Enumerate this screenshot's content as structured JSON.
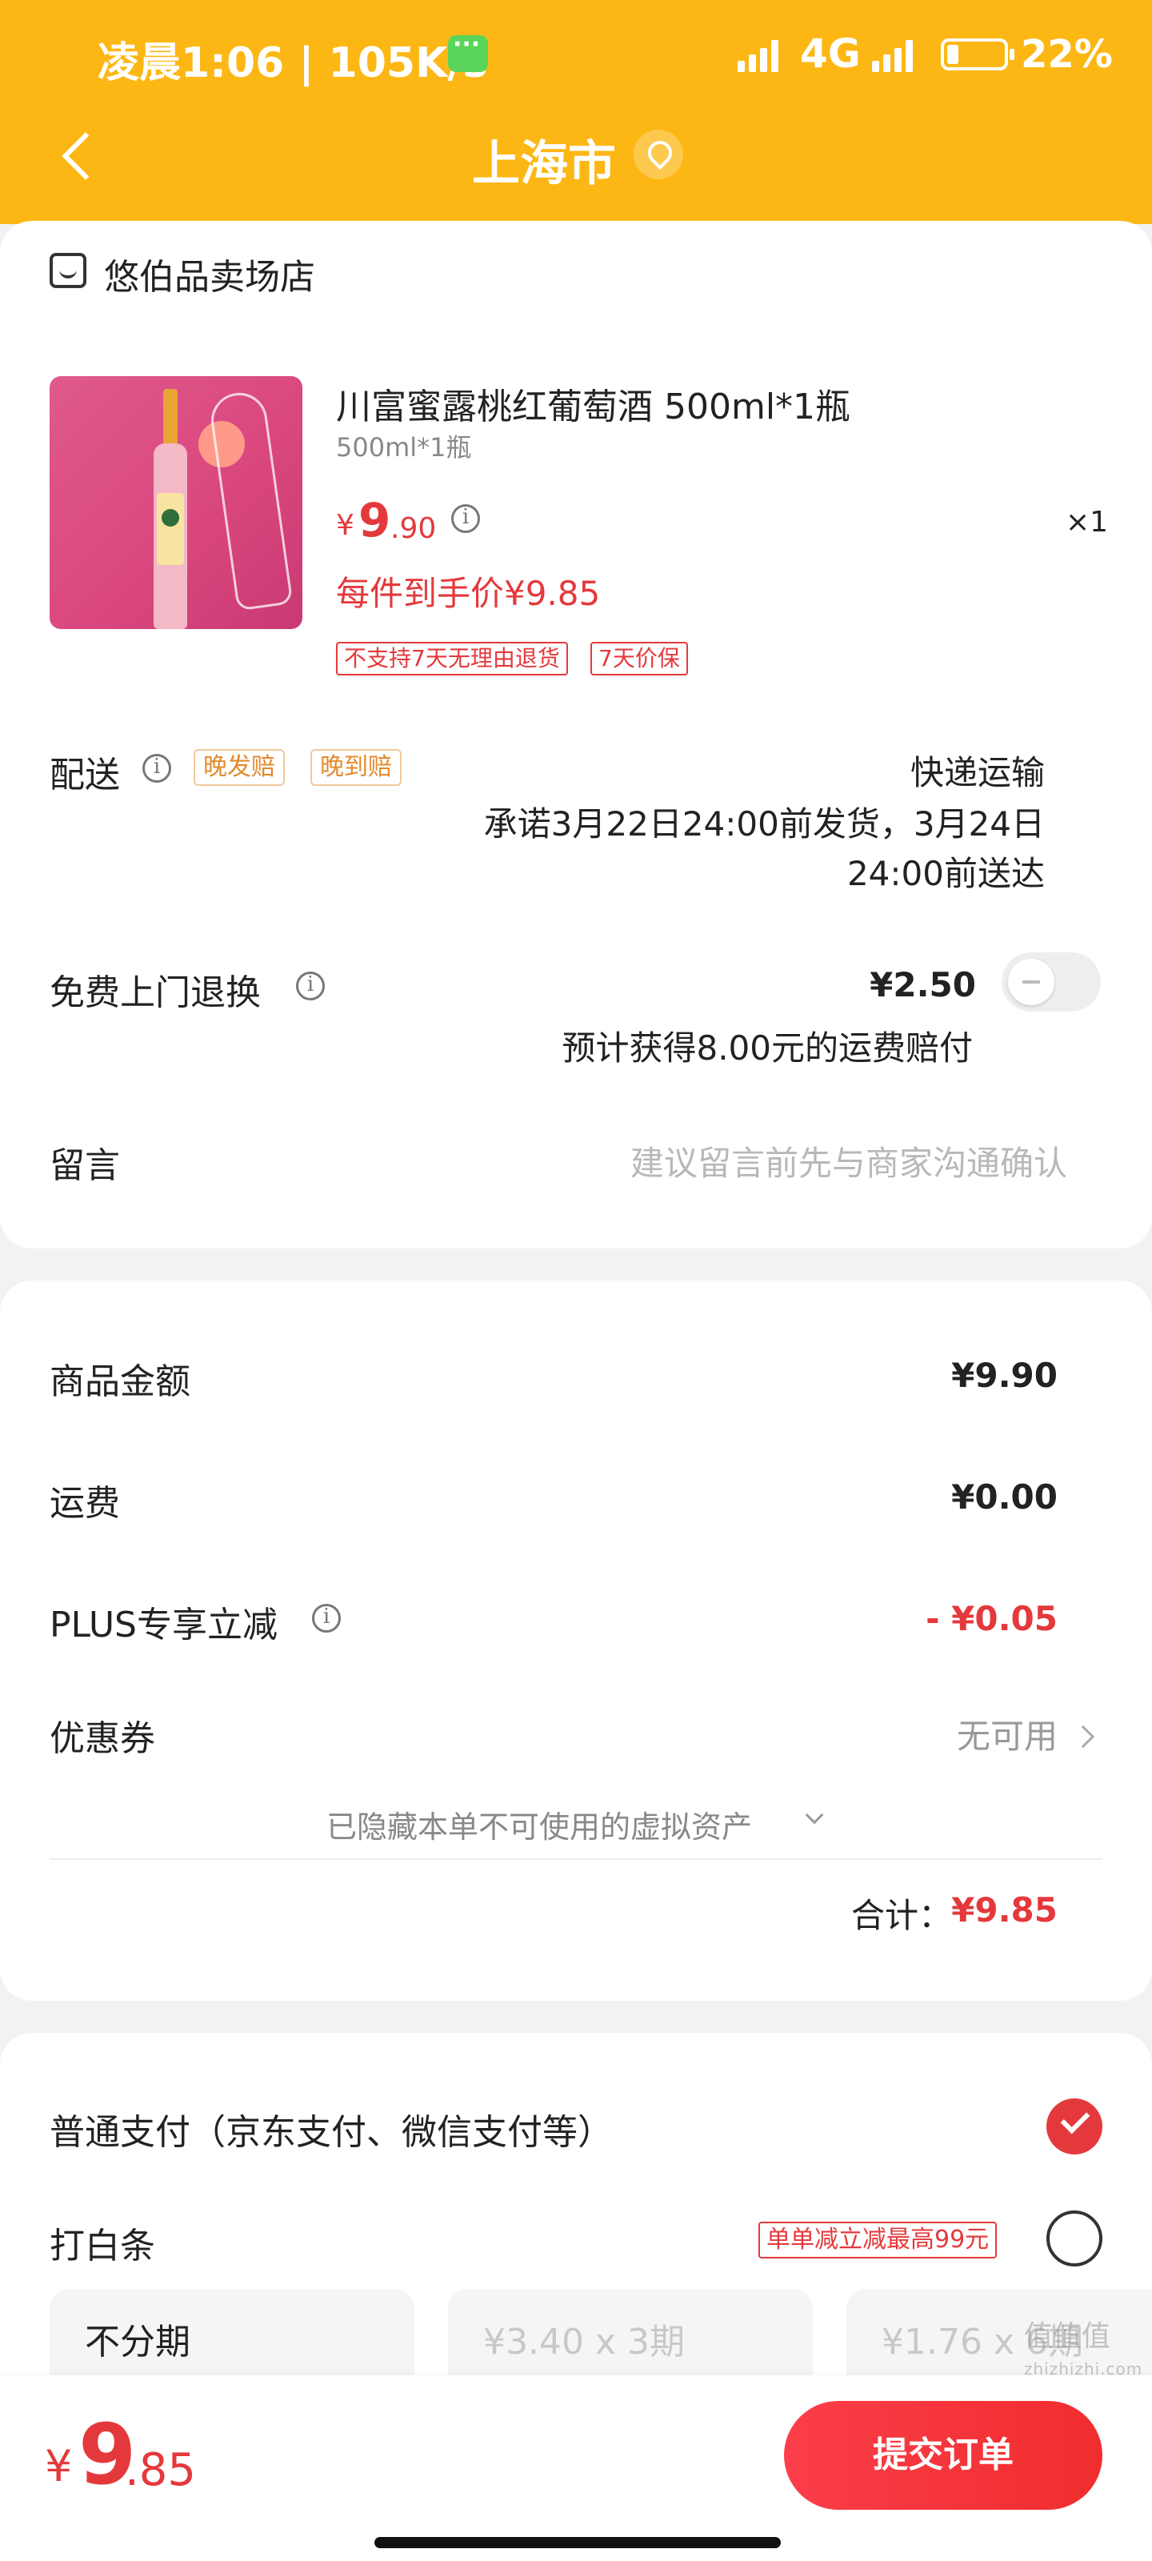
{
  "status_bar": {
    "time": "凌晨1:06 | 105K/s",
    "network": "4G",
    "battery": "22%"
  },
  "nav": {
    "title": "上海市"
  },
  "store": {
    "name": "悠伯品卖场店"
  },
  "product": {
    "name": "川富蜜露桃红葡萄酒 500ml*1瓶",
    "spec": "500ml*1瓶",
    "price_symbol": "¥",
    "price_int": "9",
    "price_dec": ".90",
    "quantity": "×1",
    "final_price": "每件到手价¥9.85",
    "tags": [
      "不支持7天无理由退货",
      "7天价保"
    ]
  },
  "delivery": {
    "label": "配送",
    "tags": [
      "晚发赔",
      "晚到赔"
    ],
    "method": "快递运输",
    "promise_line1": "承诺3月22日24:00前发货，3月24日",
    "promise_line2": "24:00前送达"
  },
  "free_return": {
    "label": "免费上门退换",
    "price": "¥2.50",
    "note": "预计获得8.00元的运费赔付"
  },
  "message": {
    "label": "留言",
    "placeholder": "建议留言前先与商家沟通确认"
  },
  "summary": {
    "goods_label": "商品金额",
    "goods_value": "¥9.90",
    "shipping_label": "运费",
    "shipping_value": "¥0.00",
    "plus_label": "PLUS专享立减",
    "plus_value": "- ¥0.05",
    "coupon_label": "优惠券",
    "coupon_value": "无可用",
    "hidden_assets": "已隐藏本单不可使用的虚拟资产",
    "total_label": "合计：",
    "total_value": "¥9.85"
  },
  "payment": {
    "normal_label": "普通支付（京东支付、微信支付等）",
    "baitiao_label": "打白条",
    "baitiao_promo": "单单减立减最高99元",
    "plans": [
      "不分期",
      "¥3.40 x 3期",
      "¥1.76 x 6期"
    ]
  },
  "bottom": {
    "total_symbol": "¥",
    "total_int": "9",
    "total_dec": ".85",
    "submit_label": "提交订单"
  },
  "watermark": {
    "main": "值值值",
    "sub": "zhizhizhi.com"
  },
  "colors": {
    "header": "#fdb714",
    "price_red": "#e4393c",
    "tag_orange": "#e38a2c"
  }
}
